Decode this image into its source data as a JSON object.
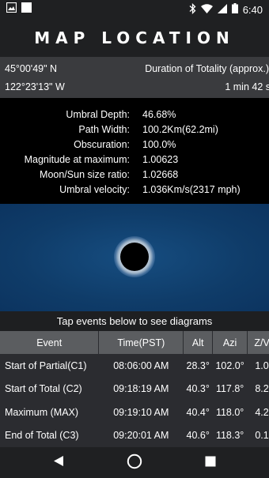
{
  "status_bar": {
    "left_icons": [
      "image-icon",
      "square-icon"
    ],
    "right_icons": [
      "bluetooth-icon",
      "wifi-icon",
      "signal-icon",
      "battery-icon"
    ],
    "time": "6:40"
  },
  "app_bar": {
    "title": "MAP LOCATION"
  },
  "coordinates": {
    "latitude": "45°00'49\" N",
    "longitude": "122°23'13\" W",
    "totality_label": "Duration of Totality (approx.)",
    "totality_value": "1 min 42 s"
  },
  "stats": [
    {
      "label": "Umbral Depth:",
      "value": "46.68%"
    },
    {
      "label": "Path Width:",
      "value": "100.2Km(62.2mi)"
    },
    {
      "label": "Obscuration:",
      "value": "100.0%"
    },
    {
      "label": "Magnitude at maximum:",
      "value": "1.00623"
    },
    {
      "label": "Moon/Sun size ratio:",
      "value": "1.02668"
    },
    {
      "label": "Umbral velocity:",
      "value": "1.036Km/s(2317 mph)"
    }
  ],
  "hint": "Tap events below to see diagrams",
  "events_table": {
    "headers": [
      "Event",
      "Time(PST)",
      "Alt",
      "Azi",
      "Z/V"
    ],
    "rows": [
      [
        "Start of Partial(C1)",
        "08:06:00 AM",
        "28.3°",
        "102.0°",
        "1.0"
      ],
      [
        "Start of Total (C2)",
        "09:18:19 AM",
        "40.3°",
        "117.8°",
        "8.2"
      ],
      [
        "Maximum (MAX)",
        "09:19:10 AM",
        "40.4°",
        "118.0°",
        "4.2"
      ],
      [
        "End of Total (C3)",
        "09:20:01 AM",
        "40.6°",
        "118.3°",
        "0.1"
      ]
    ]
  },
  "nav_bar": {
    "icons": [
      "back-icon",
      "home-icon",
      "recents-icon"
    ]
  },
  "colors": {
    "background": "#1e1f21",
    "coords_band": "#3a3b3e",
    "stats_panel": "#000000",
    "sky": "#114475",
    "table_header": "#5b5d60",
    "table_body": "#2b2c30"
  }
}
